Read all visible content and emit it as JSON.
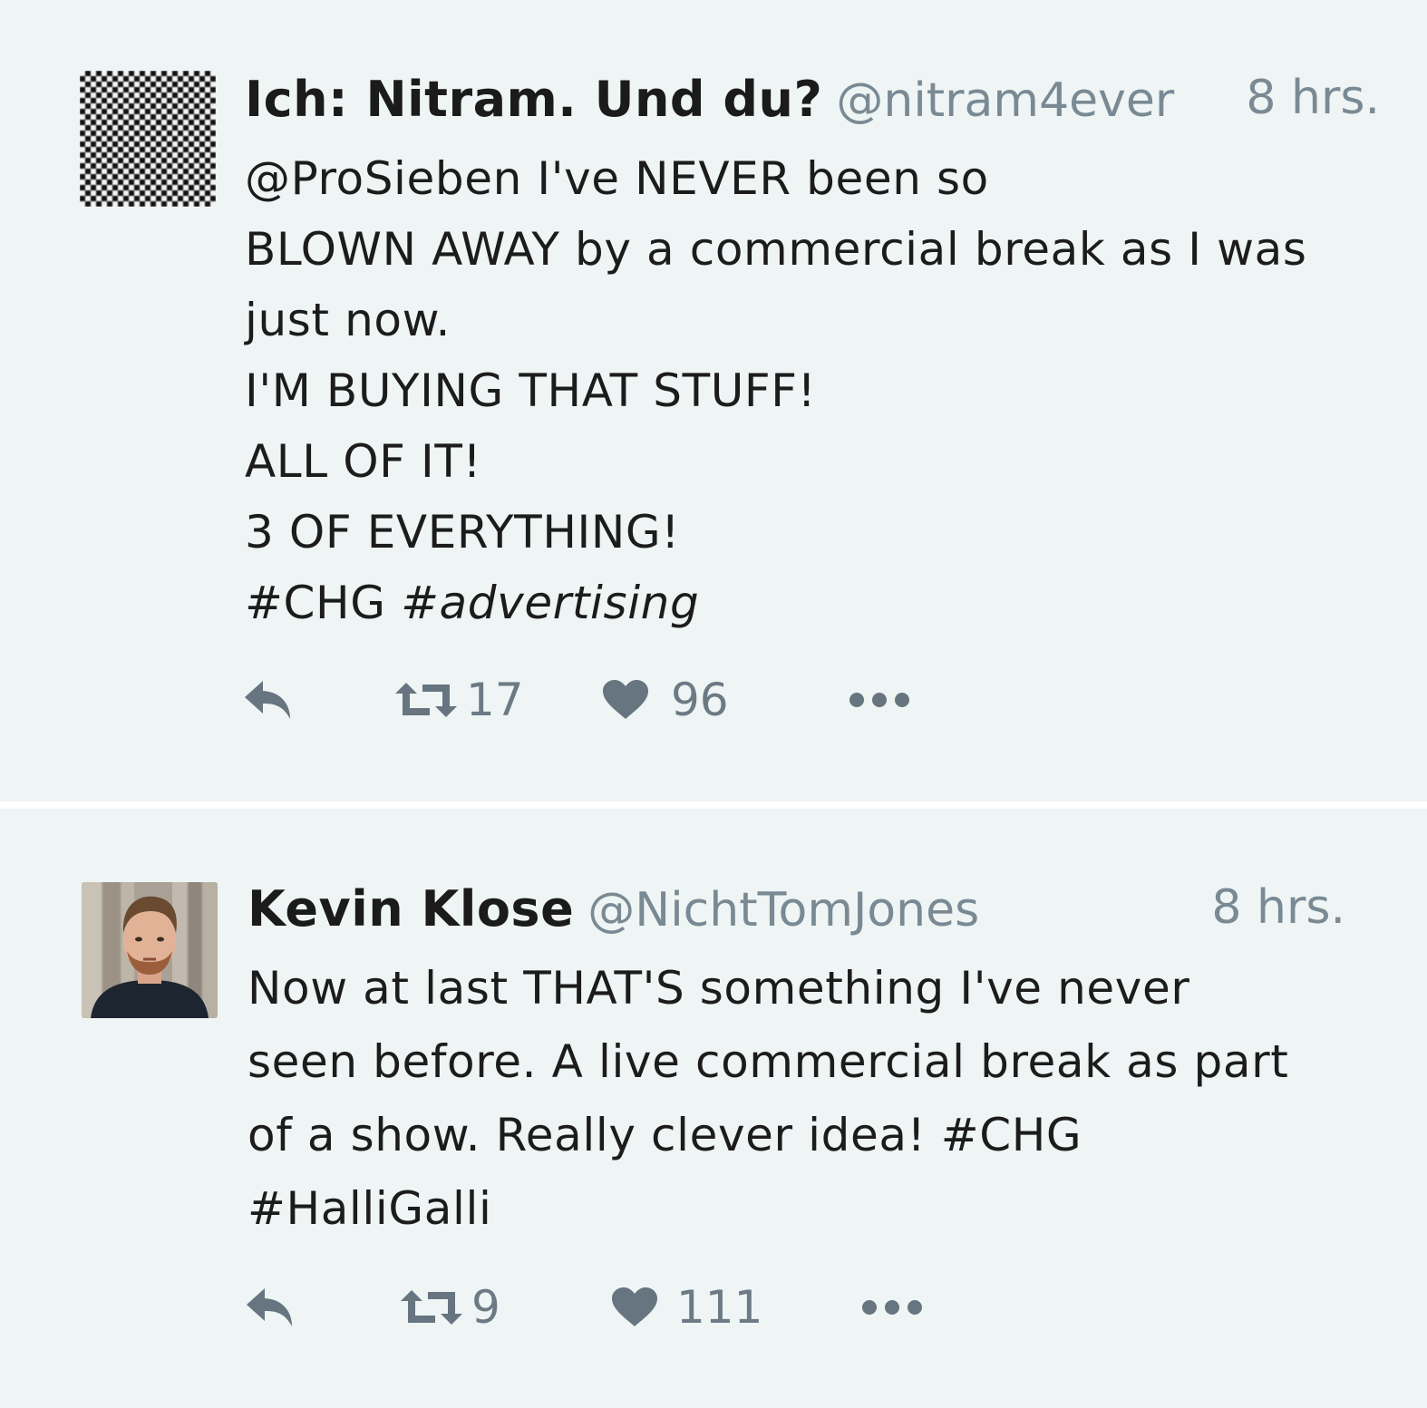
{
  "tweets": [
    {
      "name": "Ich: Nitram. Und du?",
      "handle": "@nitram4ever",
      "time": "8 hrs.",
      "lines": [
        "@ProSieben I've NEVER been so",
        "BLOWN AWAY by a commercial break as I was",
        "just now.",
        "I'M BUYING THAT STUFF!",
        "ALL OF IT!",
        "3 OF EVERYTHING!"
      ],
      "hashtag1": "#CHG",
      "hashtag2": "#advertising",
      "retweets": "17",
      "likes": "96"
    },
    {
      "name": "Kevin Klose",
      "handle": "@NichtTomJones",
      "time": "8 hrs.",
      "lines": [
        "Now at last THAT'S something I've never",
        "seen before. A live commercial break as part",
        "of a show. Really clever idea! #CHG",
        "#HalliGalli"
      ],
      "retweets": "9",
      "likes": "111"
    }
  ],
  "icons": {
    "reply": "reply-icon",
    "retweet": "retweet-icon",
    "like": "heart-icon",
    "more": "more-icon"
  },
  "colors": {
    "background": "#eef5f4",
    "divider": "#ffffff",
    "muted": "#7a8a94",
    "text": "#1c1c1c"
  }
}
